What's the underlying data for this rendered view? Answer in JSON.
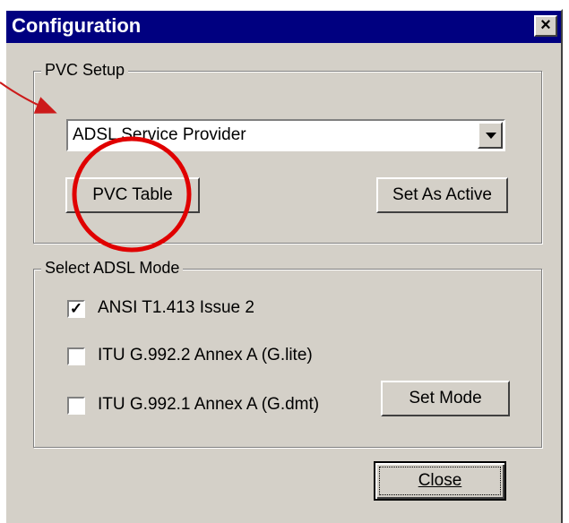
{
  "window": {
    "title": "Configuration",
    "close_glyph": "×"
  },
  "pvc_setup": {
    "legend": "PVC Setup",
    "provider_selected": "ADSL Service Provider",
    "pvc_table_button": "PVC Table",
    "set_active_button": "Set As Active"
  },
  "adsl_mode": {
    "legend": "Select ADSL Mode",
    "options": [
      {
        "label": "ANSI T1.413 Issue 2",
        "checked": true,
        "mark": "✓"
      },
      {
        "label": "ITU G.992.2 Annex A (G.lite)",
        "checked": false,
        "mark": ""
      },
      {
        "label": "ITU G.992.1 Annex A (G.dmt)",
        "checked": false,
        "mark": ""
      }
    ],
    "set_mode_button": "Set Mode"
  },
  "footer": {
    "close_button": "Close"
  },
  "annotation": {
    "arrow_color": "#cc1a1a",
    "circle_color": "#e00000"
  }
}
